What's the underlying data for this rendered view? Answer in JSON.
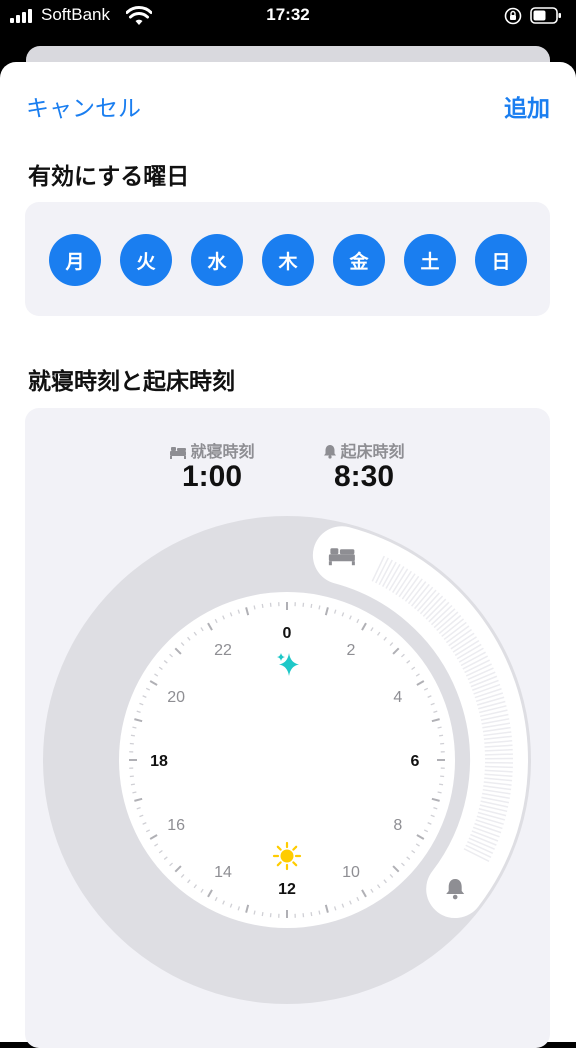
{
  "status_bar": {
    "carrier": "SoftBank",
    "time": "17:32"
  },
  "nav": {
    "cancel_label": "キャンセル",
    "add_label": "追加"
  },
  "days_section": {
    "title": "有効にする曜日",
    "days": [
      "月",
      "火",
      "水",
      "木",
      "金",
      "土",
      "日"
    ]
  },
  "sleep_section": {
    "title": "就寝時刻と起床時刻",
    "bedtime_label": "就寝時刻",
    "bedtime": "1:00",
    "wake_label": "起床時刻",
    "wake": "8:30"
  },
  "clock": {
    "hour_labels": [
      "0",
      "2",
      "4",
      "6",
      "8",
      "10",
      "12",
      "14",
      "16",
      "18",
      "20",
      "22"
    ],
    "accent": "#1a7ef0",
    "sparkle_color": "#1ec8c8",
    "sun_color": "#ffcc00"
  }
}
